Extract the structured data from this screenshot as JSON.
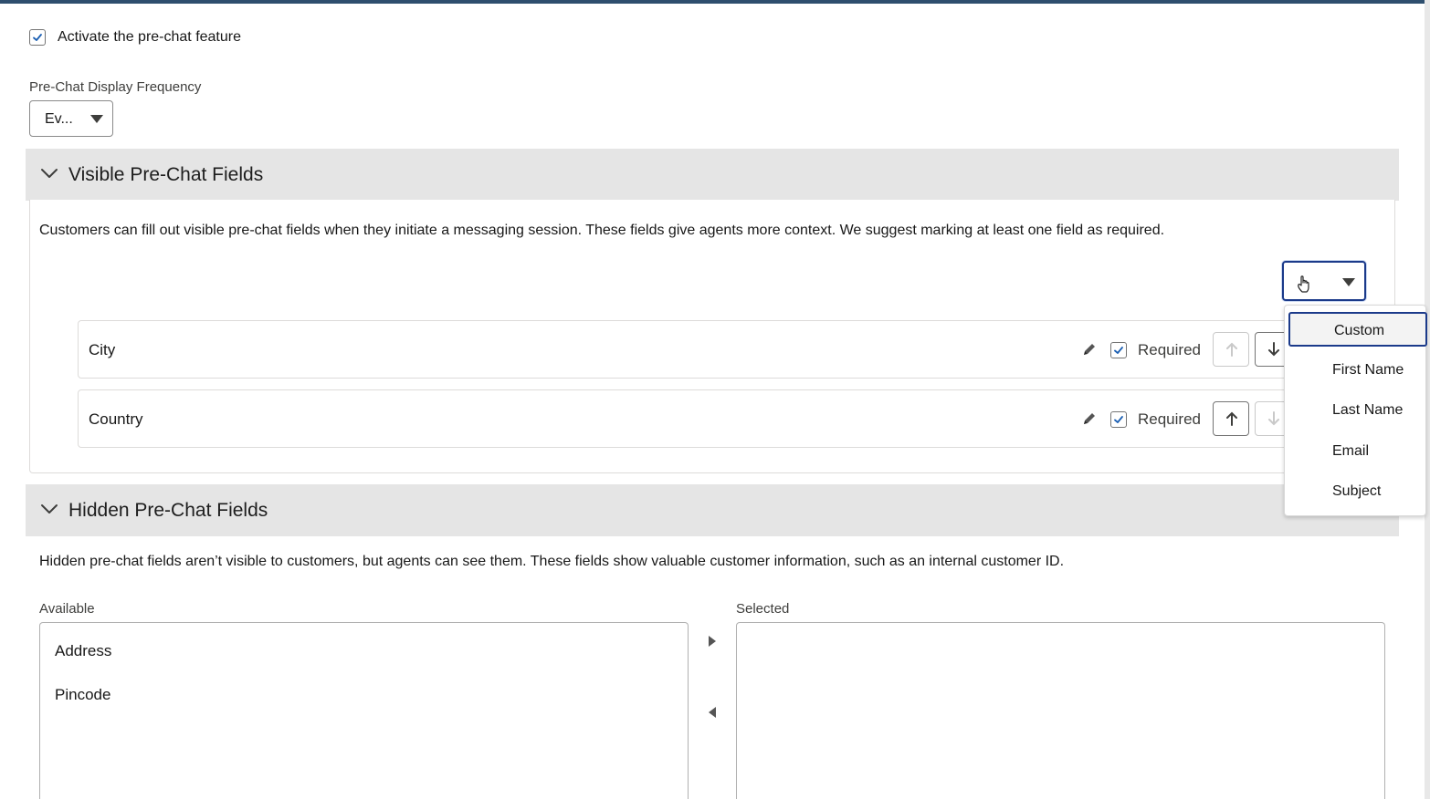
{
  "prechat": {
    "activate_label": "Activate the pre-chat feature",
    "activate_checked": true,
    "frequency_label": "Pre-Chat Display Frequency",
    "frequency_value": "Ev..."
  },
  "visible_section": {
    "title": "Visible Pre-Chat Fields",
    "description": "Customers can fill out visible pre-chat fields when they initiate a messaging session. These fields give agents more context. We suggest marking at least one field as required.",
    "add_field_value": "",
    "fields": [
      {
        "name": "City",
        "required_label": "Required",
        "required": true
      },
      {
        "name": "Country",
        "required_label": "Required",
        "required": true
      }
    ],
    "dropdown_options": [
      "Custom",
      "First Name",
      "Last Name",
      "Email",
      "Subject"
    ],
    "dropdown_selected": "Custom"
  },
  "hidden_section": {
    "title": "Hidden Pre-Chat Fields",
    "description": "Hidden pre-chat fields aren’t visible to customers, but agents can see them. These fields show valuable customer information, such as an internal customer ID.",
    "available_label": "Available",
    "selected_label": "Selected",
    "available_items": [
      "Address",
      "Pincode"
    ],
    "selected_items": []
  },
  "icons": {
    "checkbox": "checkmark-icon",
    "edit": "pencil-icon",
    "move_up": "arrow-up-icon",
    "move_down": "arrow-down-icon",
    "collapse": "chevron-down-icon",
    "dropdown": "caret-down-icon",
    "move_right": "triangle-right-icon",
    "move_left": "triangle-left-icon",
    "cursor": "hand-cursor-icon"
  },
  "colors": {
    "section_header_bg": "#e5e5e5",
    "focus_border": "#1b3a8a",
    "checkbox_check": "#1b5fb3"
  }
}
